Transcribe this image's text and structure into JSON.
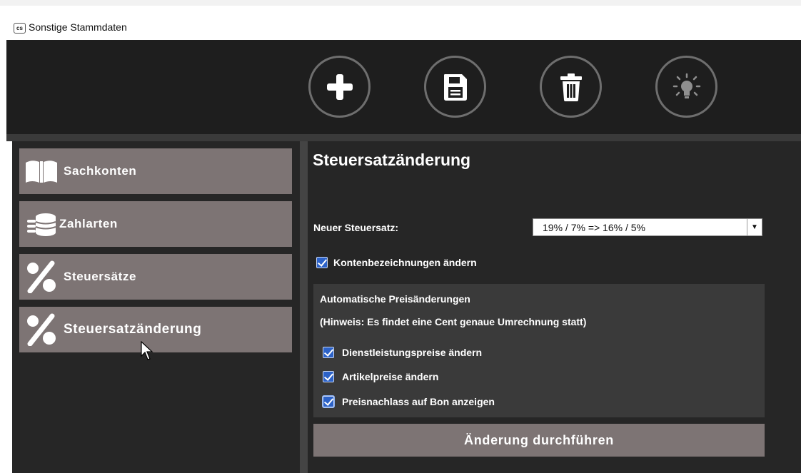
{
  "window": {
    "logo_text": "cs",
    "title": "Sonstige Stammdaten"
  },
  "toolbar": {
    "buttons": [
      {
        "name": "add",
        "icon": "plus-icon"
      },
      {
        "name": "save",
        "icon": "floppy-disk-icon"
      },
      {
        "name": "delete",
        "icon": "trash-icon"
      },
      {
        "name": "hint",
        "icon": "lightbulb-icon"
      }
    ]
  },
  "sidebar": {
    "items": [
      {
        "label": "Sachkonten",
        "icon": "book-icon"
      },
      {
        "label": "Zahlarten",
        "icon": "coins-icon"
      },
      {
        "label": "Steuersätze",
        "icon": "percent-icon"
      },
      {
        "label": "Steuersatzänderung",
        "icon": "percent-icon",
        "active": true
      }
    ]
  },
  "main": {
    "title": "Steuersatzänderung",
    "rate_label": "Neuer Steuersatz:",
    "rate_select": {
      "value": "19% / 7% => 16% / 5%"
    },
    "rename_accounts": {
      "label": "Kontenbezeichnungen ändern",
      "checked": true
    },
    "price_changes": {
      "title": "Automatische Preisänderungen",
      "hint": "(Hinweis: Es findet eine Cent genaue Umrechnung statt)",
      "options": [
        {
          "label": "Dienstleistungspreise ändern",
          "checked": true
        },
        {
          "label": "Artikelpreise ändern",
          "checked": true
        },
        {
          "label": "Preisnachlass auf Bon anzeigen",
          "checked": true
        }
      ]
    },
    "apply_label": "Änderung durchführen"
  },
  "colors": {
    "toolbar_bg": "#1e1e1e",
    "panel_bg": "#262626",
    "nav_item_bg": "#7d7474",
    "checkbox": "#2c62c8"
  }
}
